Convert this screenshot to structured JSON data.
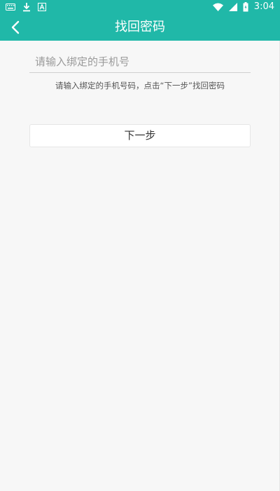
{
  "status_bar": {
    "time": "3:04",
    "icons_left": [
      "keyboard-icon",
      "download-icon",
      "text-a-icon"
    ],
    "icons_right": [
      "wifi-icon",
      "signal-icon",
      "battery-icon"
    ]
  },
  "app_bar": {
    "title": "找回密码",
    "back_icon": "chevron-left-icon",
    "background_color": "#20b8a8"
  },
  "form": {
    "phone_input": {
      "placeholder": "请输入绑定的手机号",
      "value": ""
    },
    "hint": "请输入绑定的手机号码，点击“下一步”找回密码",
    "next_button_label": "下一步"
  }
}
